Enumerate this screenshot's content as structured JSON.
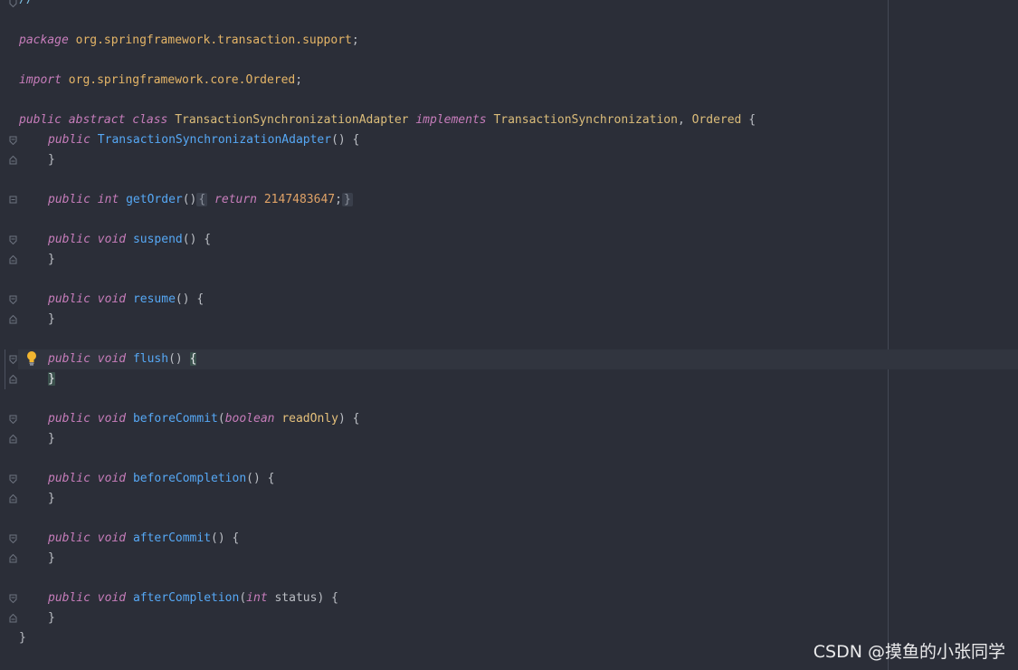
{
  "editor": {
    "top_comment": "//",
    "package_kw": "package",
    "package_name": "org.springframework.transaction.support",
    "semicolon": ";",
    "import_kw": "import",
    "import_name": "org.springframework.core.Ordered",
    "class_decl": {
      "public": "public",
      "abstract": "abstract",
      "class": "class",
      "name": "TransactionSynchronizationAdapter",
      "implements": "implements",
      "iface1": "TransactionSynchronization",
      "comma": ",",
      "iface2": "Ordered",
      "open": "{"
    },
    "ctor": {
      "public": "public",
      "name": "TransactionSynchronizationAdapter",
      "sig": "() {",
      "close": "}"
    },
    "get_order": {
      "public": "public",
      "type": "int",
      "name": "getOrder",
      "parens": "()",
      "open": "{",
      "return_kw": "return",
      "value": "2147483647",
      "semi": ";",
      "close": "}"
    },
    "methods": [
      {
        "public": "public",
        "type": "void",
        "name": "suspend",
        "params_open": "(",
        "param_type": "",
        "param_name": "",
        "sig_end": ") {",
        "close": "}"
      },
      {
        "public": "public",
        "type": "void",
        "name": "resume",
        "params_open": "(",
        "param_type": "",
        "param_name": "",
        "sig_end": ") {",
        "close": "}"
      },
      {
        "public": "public",
        "type": "void",
        "name": "flush",
        "params_open": "(",
        "param_type": "",
        "param_name": "",
        "sig_end": ") ",
        "open_brace": "{",
        "close": "}"
      },
      {
        "public": "public",
        "type": "void",
        "name": "beforeCommit",
        "params_open": "(",
        "param_type": "boolean",
        "param_name": "readOnly",
        "sig_end": ") {",
        "close": "}"
      },
      {
        "public": "public",
        "type": "void",
        "name": "beforeCompletion",
        "params_open": "(",
        "param_type": "",
        "param_name": "",
        "sig_end": ") {",
        "close": "}"
      },
      {
        "public": "public",
        "type": "void",
        "name": "afterCommit",
        "params_open": "(",
        "param_type": "",
        "param_name": "",
        "sig_end": ") {",
        "close": "}"
      },
      {
        "public": "public",
        "type": "void",
        "name": "afterCompletion",
        "params_open": "(",
        "param_type": "int",
        "param_name": "status",
        "sig_end": ") {",
        "close": "}"
      }
    ],
    "class_close": "}",
    "param_space": " "
  },
  "watermark": "CSDN @摸鱼的小张同学",
  "icons": {
    "fold": "fold-marker-icon",
    "bulb": "lightbulb-intention-icon"
  },
  "colors": {
    "background": "#2b2e38",
    "keyword": "#c77dbb",
    "function": "#56a8f5",
    "class": "#dcbd7a",
    "number": "#e0a367"
  }
}
